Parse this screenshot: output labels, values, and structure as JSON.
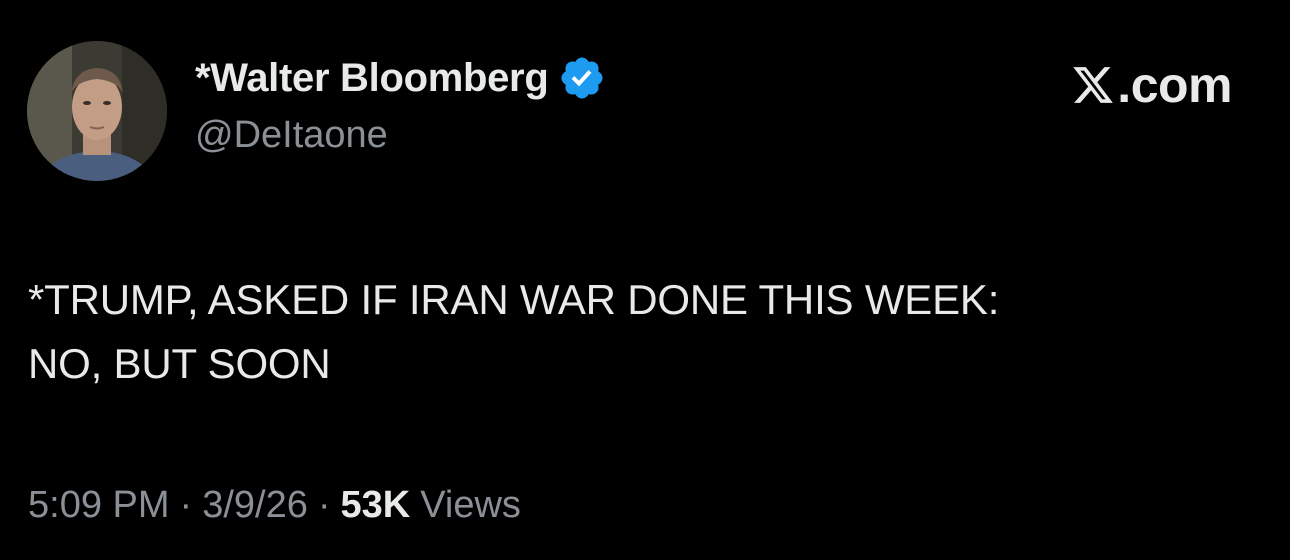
{
  "author": {
    "display_name": "*Walter Bloomberg",
    "handle": "@DeItaone",
    "verified": true,
    "avatar_icon": "profile-photo",
    "badge_icon": "verified-badge-icon",
    "badge_color": "#1d9bf0"
  },
  "source": {
    "logo_label": ".com",
    "logo_icon": "x-logo-icon"
  },
  "tweet": {
    "text_lines": [
      "*TRUMP, ASKED IF IRAN WAR DONE THIS WEEK:",
      "NO, BUT SOON"
    ]
  },
  "meta": {
    "time": "5:09 PM",
    "separator": "·",
    "date": "3/9/26",
    "views_count": "53K",
    "views_label": "Views"
  },
  "colors": {
    "background": "#000000",
    "primary_text": "#e7e9ea",
    "secondary_text": "#8b9096",
    "accent": "#1d9bf0"
  }
}
